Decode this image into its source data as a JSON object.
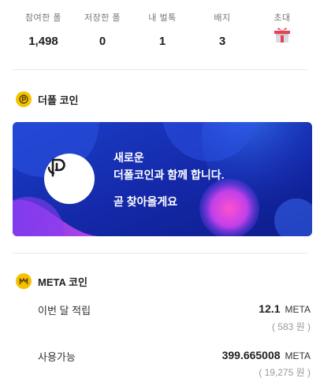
{
  "stats": [
    {
      "label": "참여한 폴",
      "value": "1,498"
    },
    {
      "label": "저장한 폴",
      "value": "0"
    },
    {
      "label": "내 벌톡",
      "value": "1"
    },
    {
      "label": "배지",
      "value": "3"
    },
    {
      "label": "초대",
      "value": ""
    }
  ],
  "depol": {
    "title": "더폴 코인",
    "banner_line1": "새로운",
    "banner_line2": "더폴코인과 함께 합니다.",
    "banner_line3": "곧 찾아올게요"
  },
  "meta": {
    "title": "META 코인",
    "monthly_label": "이번 달 적립",
    "monthly_value": "12.1",
    "monthly_unit": "META",
    "monthly_won": "( 583 원 )",
    "available_label": "사용가능",
    "available_value": "399.665008",
    "available_unit": "META",
    "available_won": "( 19,275 원 )"
  },
  "colors": {
    "coin_gold": "#f6c200",
    "banner_blue": "#1a2fb0",
    "gift_red": "#e8414f"
  }
}
